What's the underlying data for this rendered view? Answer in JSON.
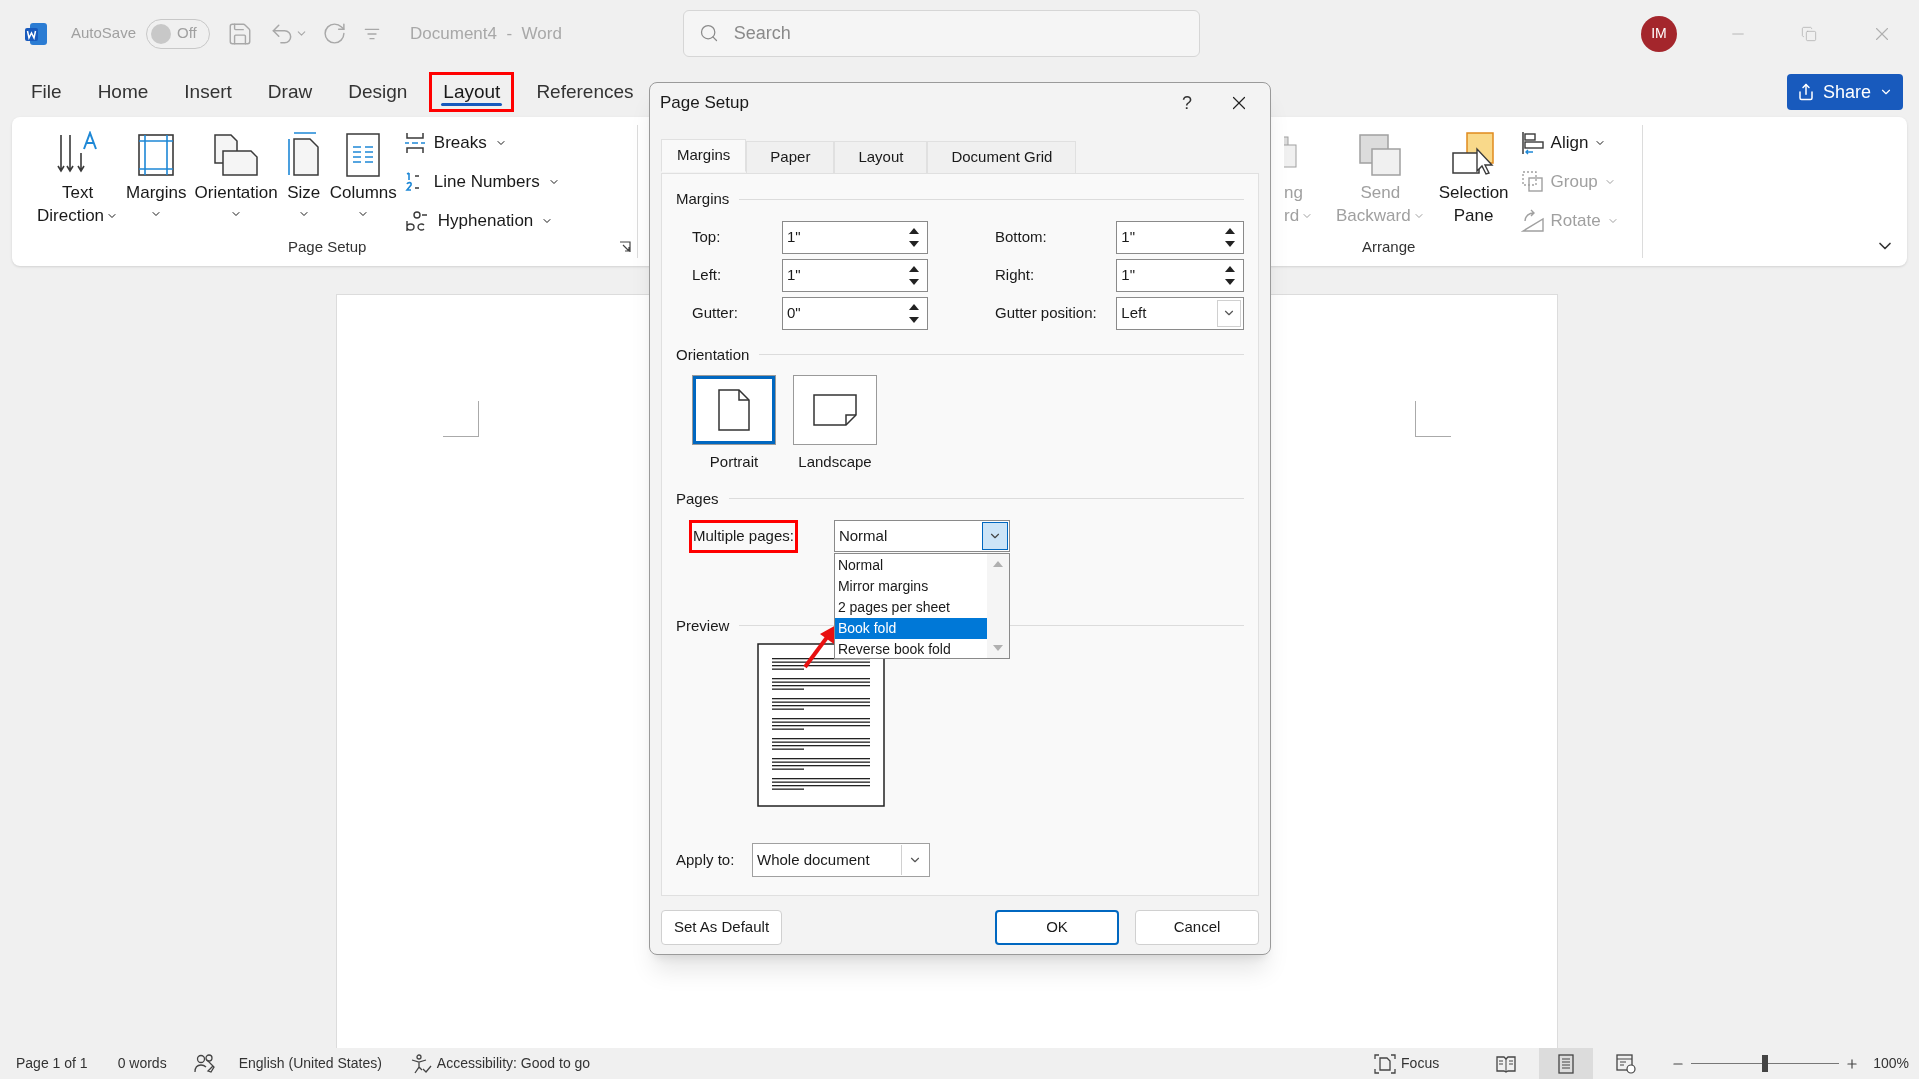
{
  "title_bar": {
    "autosave_label": "AutoSave",
    "autosave_toggle": {
      "label": "Off",
      "on": false
    },
    "document_title": "Document4  -  Word",
    "search": {
      "placeholder": "Search"
    },
    "avatar": "IM"
  },
  "ribbon_tabs": [
    {
      "label": "File",
      "selected": false,
      "highlighted": false
    },
    {
      "label": "Home",
      "selected": false,
      "highlighted": false
    },
    {
      "label": "Insert",
      "selected": false,
      "highlighted": false
    },
    {
      "label": "Draw",
      "selected": false,
      "highlighted": false
    },
    {
      "label": "Design",
      "selected": false,
      "highlighted": false
    },
    {
      "label": "Layout",
      "selected": true,
      "highlighted": true
    },
    {
      "label": "References",
      "selected": false,
      "highlighted": false
    }
  ],
  "share_button": {
    "label": "Share"
  },
  "page_setup_group": {
    "label": "Page Setup",
    "large_buttons": [
      {
        "kind": "text_direction",
        "lines": [
          "Text",
          "Direction"
        ]
      },
      {
        "kind": "margins",
        "lines": [
          "Margins"
        ]
      },
      {
        "kind": "orientation",
        "lines": [
          "Orientation"
        ]
      },
      {
        "kind": "size",
        "lines": [
          "Size"
        ]
      },
      {
        "kind": "columns",
        "lines": [
          "Columns"
        ]
      }
    ],
    "small_buttons": [
      {
        "kind": "breaks",
        "label": "Breaks"
      },
      {
        "kind": "line_numbers",
        "label": "Line Numbers"
      },
      {
        "kind": "hyphenation",
        "label": "Hyphenation"
      }
    ]
  },
  "arrange_group": {
    "label": "Arrange",
    "partial_lines": [
      "ng",
      "rd"
    ],
    "large_buttons": [
      {
        "kind": "send_backward",
        "lines": [
          "Send",
          "Backward"
        ],
        "disabled": true
      },
      {
        "kind": "selection_pane",
        "lines": [
          "Selection",
          "Pane"
        ],
        "disabled": false
      }
    ],
    "small_buttons": [
      {
        "kind": "align",
        "label": "Align",
        "disabled": false
      },
      {
        "kind": "group",
        "label": "Group",
        "disabled": true
      },
      {
        "kind": "rotate",
        "label": "Rotate",
        "disabled": true
      }
    ]
  },
  "dialog": {
    "title": "Page Setup",
    "help": "?",
    "tabs": [
      {
        "label": "Margins",
        "selected": true
      },
      {
        "label": "Paper",
        "selected": false
      },
      {
        "label": "Layout",
        "selected": false
      },
      {
        "label": "Document Grid",
        "selected": false
      }
    ],
    "margins": {
      "heading": "Margins",
      "fields": [
        {
          "label": "Top:",
          "value": "1\"",
          "kind": "spin"
        },
        {
          "label": "Bottom:",
          "value": "1\"",
          "kind": "spin"
        },
        {
          "label": "Left:",
          "value": "1\"",
          "kind": "spin"
        },
        {
          "label": "Right:",
          "value": "1\"",
          "kind": "spin"
        },
        {
          "label": "Gutter:",
          "value": "0\"",
          "kind": "spin"
        },
        {
          "label": "Gutter position:",
          "value": "Left",
          "kind": "combo"
        }
      ]
    },
    "orientation": {
      "heading": "Orientation",
      "options": [
        {
          "kind": "portrait",
          "label": "Portrait",
          "selected": true
        },
        {
          "kind": "landscape",
          "label": "Landscape",
          "selected": false
        }
      ]
    },
    "pages": {
      "heading": "Pages",
      "multiple_pages": {
        "label": "Multiple pages:",
        "highlighted": true,
        "value": "Normal",
        "expanded": true,
        "options": [
          {
            "label": "Normal",
            "highlighted": false
          },
          {
            "label": "Mirror margins",
            "highlighted": false
          },
          {
            "label": "2 pages per sheet",
            "highlighted": false
          },
          {
            "label": "Book fold",
            "highlighted": true
          },
          {
            "label": "Reverse book fold",
            "highlighted": false
          }
        ]
      }
    },
    "preview": {
      "heading": "Preview"
    },
    "apply_to": {
      "label": "Apply to:",
      "value": "Whole document"
    },
    "buttons": [
      {
        "label": "Set As Default",
        "kind": "secondary"
      },
      {
        "label": "OK",
        "kind": "default"
      },
      {
        "label": "Cancel",
        "kind": "secondary"
      }
    ]
  },
  "status_bar": {
    "page": "Page 1 of 1",
    "words": "0 words",
    "language": "English (United States)",
    "accessibility": "Accessibility: Good to go",
    "focus": "Focus",
    "views": [
      {
        "kind": "read",
        "selected": false
      },
      {
        "kind": "print",
        "selected": true
      },
      {
        "kind": "web",
        "selected": false
      }
    ],
    "zoom": {
      "level": 0.5,
      "label": "100%"
    }
  }
}
